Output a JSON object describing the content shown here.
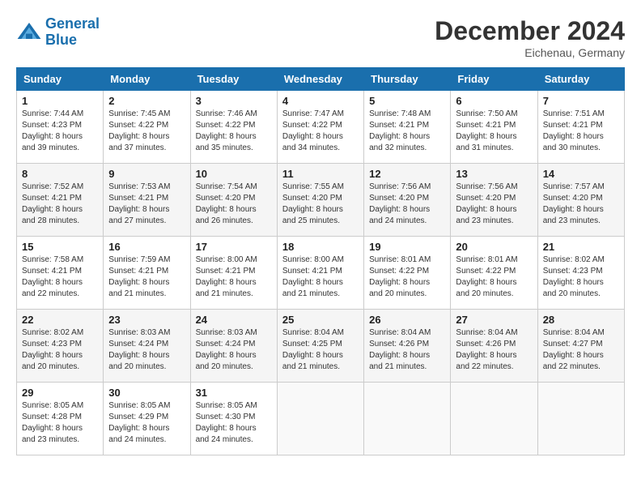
{
  "header": {
    "logo_line1": "General",
    "logo_line2": "Blue",
    "month_title": "December 2024",
    "location": "Eichenau, Germany"
  },
  "weekdays": [
    "Sunday",
    "Monday",
    "Tuesday",
    "Wednesday",
    "Thursday",
    "Friday",
    "Saturday"
  ],
  "weeks": [
    [
      {
        "day": "1",
        "info": "Sunrise: 7:44 AM\nSunset: 4:23 PM\nDaylight: 8 hours\nand 39 minutes."
      },
      {
        "day": "2",
        "info": "Sunrise: 7:45 AM\nSunset: 4:22 PM\nDaylight: 8 hours\nand 37 minutes."
      },
      {
        "day": "3",
        "info": "Sunrise: 7:46 AM\nSunset: 4:22 PM\nDaylight: 8 hours\nand 35 minutes."
      },
      {
        "day": "4",
        "info": "Sunrise: 7:47 AM\nSunset: 4:22 PM\nDaylight: 8 hours\nand 34 minutes."
      },
      {
        "day": "5",
        "info": "Sunrise: 7:48 AM\nSunset: 4:21 PM\nDaylight: 8 hours\nand 32 minutes."
      },
      {
        "day": "6",
        "info": "Sunrise: 7:50 AM\nSunset: 4:21 PM\nDaylight: 8 hours\nand 31 minutes."
      },
      {
        "day": "7",
        "info": "Sunrise: 7:51 AM\nSunset: 4:21 PM\nDaylight: 8 hours\nand 30 minutes."
      }
    ],
    [
      {
        "day": "8",
        "info": "Sunrise: 7:52 AM\nSunset: 4:21 PM\nDaylight: 8 hours\nand 28 minutes."
      },
      {
        "day": "9",
        "info": "Sunrise: 7:53 AM\nSunset: 4:21 PM\nDaylight: 8 hours\nand 27 minutes."
      },
      {
        "day": "10",
        "info": "Sunrise: 7:54 AM\nSunset: 4:20 PM\nDaylight: 8 hours\nand 26 minutes."
      },
      {
        "day": "11",
        "info": "Sunrise: 7:55 AM\nSunset: 4:20 PM\nDaylight: 8 hours\nand 25 minutes."
      },
      {
        "day": "12",
        "info": "Sunrise: 7:56 AM\nSunset: 4:20 PM\nDaylight: 8 hours\nand 24 minutes."
      },
      {
        "day": "13",
        "info": "Sunrise: 7:56 AM\nSunset: 4:20 PM\nDaylight: 8 hours\nand 23 minutes."
      },
      {
        "day": "14",
        "info": "Sunrise: 7:57 AM\nSunset: 4:20 PM\nDaylight: 8 hours\nand 23 minutes."
      }
    ],
    [
      {
        "day": "15",
        "info": "Sunrise: 7:58 AM\nSunset: 4:21 PM\nDaylight: 8 hours\nand 22 minutes."
      },
      {
        "day": "16",
        "info": "Sunrise: 7:59 AM\nSunset: 4:21 PM\nDaylight: 8 hours\nand 21 minutes."
      },
      {
        "day": "17",
        "info": "Sunrise: 8:00 AM\nSunset: 4:21 PM\nDaylight: 8 hours\nand 21 minutes."
      },
      {
        "day": "18",
        "info": "Sunrise: 8:00 AM\nSunset: 4:21 PM\nDaylight: 8 hours\nand 21 minutes."
      },
      {
        "day": "19",
        "info": "Sunrise: 8:01 AM\nSunset: 4:22 PM\nDaylight: 8 hours\nand 20 minutes."
      },
      {
        "day": "20",
        "info": "Sunrise: 8:01 AM\nSunset: 4:22 PM\nDaylight: 8 hours\nand 20 minutes."
      },
      {
        "day": "21",
        "info": "Sunrise: 8:02 AM\nSunset: 4:23 PM\nDaylight: 8 hours\nand 20 minutes."
      }
    ],
    [
      {
        "day": "22",
        "info": "Sunrise: 8:02 AM\nSunset: 4:23 PM\nDaylight: 8 hours\nand 20 minutes."
      },
      {
        "day": "23",
        "info": "Sunrise: 8:03 AM\nSunset: 4:24 PM\nDaylight: 8 hours\nand 20 minutes."
      },
      {
        "day": "24",
        "info": "Sunrise: 8:03 AM\nSunset: 4:24 PM\nDaylight: 8 hours\nand 20 minutes."
      },
      {
        "day": "25",
        "info": "Sunrise: 8:04 AM\nSunset: 4:25 PM\nDaylight: 8 hours\nand 21 minutes."
      },
      {
        "day": "26",
        "info": "Sunrise: 8:04 AM\nSunset: 4:26 PM\nDaylight: 8 hours\nand 21 minutes."
      },
      {
        "day": "27",
        "info": "Sunrise: 8:04 AM\nSunset: 4:26 PM\nDaylight: 8 hours\nand 22 minutes."
      },
      {
        "day": "28",
        "info": "Sunrise: 8:04 AM\nSunset: 4:27 PM\nDaylight: 8 hours\nand 22 minutes."
      }
    ],
    [
      {
        "day": "29",
        "info": "Sunrise: 8:05 AM\nSunset: 4:28 PM\nDaylight: 8 hours\nand 23 minutes."
      },
      {
        "day": "30",
        "info": "Sunrise: 8:05 AM\nSunset: 4:29 PM\nDaylight: 8 hours\nand 24 minutes."
      },
      {
        "day": "31",
        "info": "Sunrise: 8:05 AM\nSunset: 4:30 PM\nDaylight: 8 hours\nand 24 minutes."
      },
      {
        "day": "",
        "info": ""
      },
      {
        "day": "",
        "info": ""
      },
      {
        "day": "",
        "info": ""
      },
      {
        "day": "",
        "info": ""
      }
    ]
  ]
}
